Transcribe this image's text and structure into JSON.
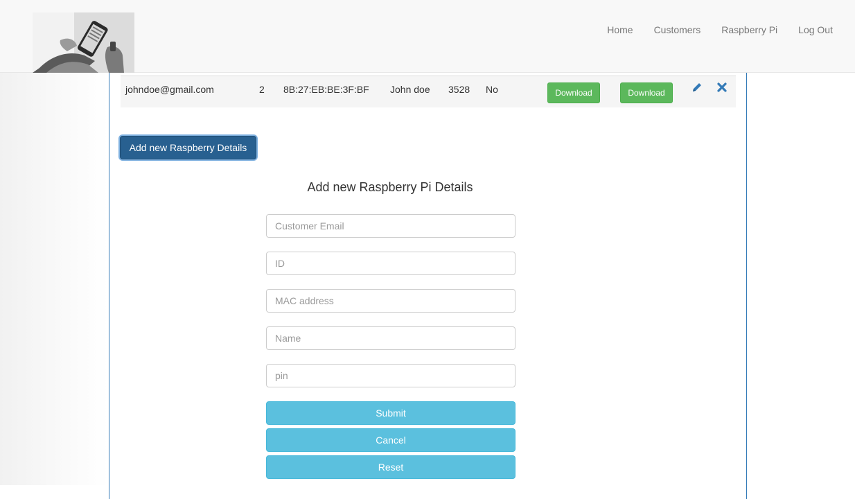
{
  "nav": {
    "items": [
      "Home",
      "Customers",
      "Raspberry Pi",
      "Log Out"
    ]
  },
  "table": {
    "row": {
      "email": "johndoe@gmail.com",
      "id": "2",
      "mac": "8B:27:EB:BE:3F:BF",
      "name": "John doe",
      "pin": "3528",
      "flag": "No",
      "download1": "Download",
      "download2": "Download"
    }
  },
  "add_button": "Add new Raspberry Details",
  "form": {
    "title": "Add new Raspberry Pi Details",
    "email_placeholder": "Customer Email",
    "id_placeholder": "ID",
    "mac_placeholder": "MAC address",
    "name_placeholder": "Name",
    "pin_placeholder": "pin",
    "submit": "Submit",
    "cancel": "Cancel",
    "reset": "Reset"
  },
  "colors": {
    "primary": "#286090",
    "success": "#5cb85c",
    "info": "#5bc0de",
    "link_icon": "#337ab7"
  },
  "icons": {
    "edit": "pencil-icon",
    "delete": "close-icon"
  }
}
